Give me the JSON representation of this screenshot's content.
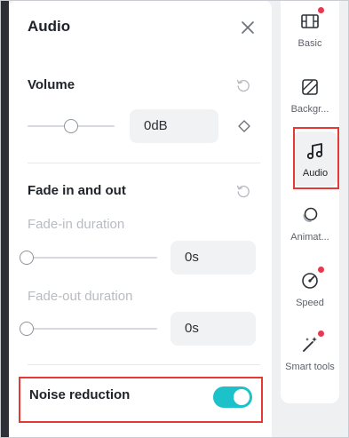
{
  "panel": {
    "title": "Audio",
    "volume": {
      "title": "Volume",
      "value": "0dB",
      "level": 0.5
    },
    "fade": {
      "title": "Fade in and out",
      "fade_in_label": "Fade-in duration",
      "fade_in_value": "0s",
      "fade_in_level": 0,
      "fade_out_label": "Fade-out duration",
      "fade_out_value": "0s",
      "fade_out_level": 0
    },
    "noise_reduction": {
      "label": "Noise reduction",
      "enabled": true
    }
  },
  "rail": {
    "items": [
      {
        "label": "Basic",
        "icon": "film-icon",
        "dot": true
      },
      {
        "label": "Backgr...",
        "icon": "background-icon",
        "dot": false
      },
      {
        "label": "Audio",
        "icon": "music-note-icon",
        "dot": false,
        "active": true
      },
      {
        "label": "Animat...",
        "icon": "animation-icon",
        "dot": false
      },
      {
        "label": "Speed",
        "icon": "speed-icon",
        "dot": true
      },
      {
        "label": "Smart tools",
        "icon": "magic-wand-icon",
        "dot": true
      }
    ]
  },
  "colors": {
    "accent": "#1cc1c9",
    "highlight": "#e53935",
    "dot": "#e53950"
  }
}
